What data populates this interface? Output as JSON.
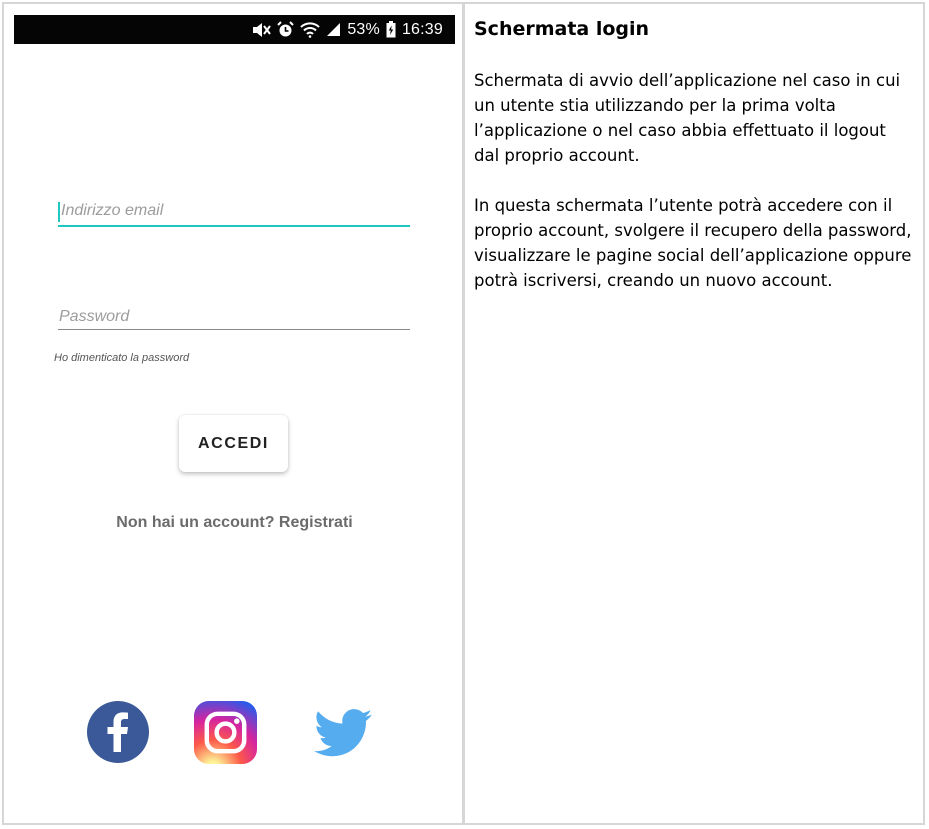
{
  "status_bar": {
    "battery": "53%",
    "time": "16:39",
    "icons": [
      "mute-icon",
      "alarm-icon",
      "wifi-icon",
      "signal-icon",
      "battery-icon"
    ]
  },
  "login": {
    "email_placeholder": "Indirizzo email",
    "password_placeholder": "Password",
    "forgot_password": "Ho dimenticato la password",
    "submit_label": "ACCEDI",
    "register_link": "Non hai un account? Registrati",
    "accent_color": "#1ec8c0"
  },
  "social": [
    {
      "name": "facebook-icon",
      "color": "#3b5998"
    },
    {
      "name": "instagram-icon",
      "color": "#d6249f"
    },
    {
      "name": "twitter-icon",
      "color": "#55acee"
    }
  ],
  "description": {
    "title": "Schermata login",
    "paragraphs": [
      "Schermata di avvio dell’applicazione nel caso in cui un utente stia utilizzando per la prima volta l’applicazione o nel caso abbia effettuato il logout dal proprio account.",
      "In questa schermata l’utente potrà accedere con il proprio account, svolgere il recupero della password, visualizzare le pagine social dell’applicazione oppure potrà iscriversi, creando un nuovo account."
    ]
  }
}
